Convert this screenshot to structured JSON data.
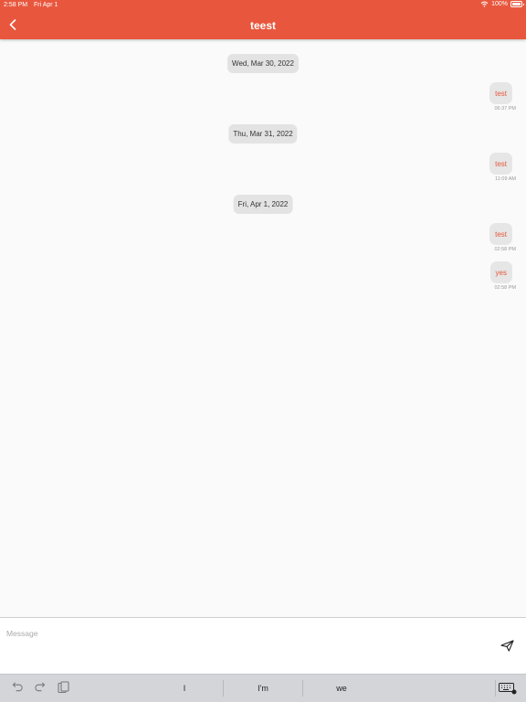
{
  "status_bar": {
    "time": "2:58 PM",
    "date": "Fri Apr 1",
    "battery": "100%"
  },
  "header": {
    "title": "teest"
  },
  "messages": [
    {
      "date": "Wed, Mar 30, 2022",
      "text": "test",
      "time": "06:37 PM"
    },
    {
      "date": "Thu, Mar 31, 2022",
      "text": "test",
      "time": "11:09 AM"
    },
    {
      "date": "Fri, Apr 1, 2022",
      "text": "test",
      "time": "02:58 PM"
    },
    {
      "text": "yes",
      "time": "02:58 PM"
    }
  ],
  "composer": {
    "placeholder": "Message"
  },
  "keyboard": {
    "suggestions": [
      "I",
      "I'm",
      "we"
    ]
  },
  "colors": {
    "accent": "#e8573d",
    "bubble": "#e6e6e6",
    "date_pill": "#e3e3e3"
  }
}
